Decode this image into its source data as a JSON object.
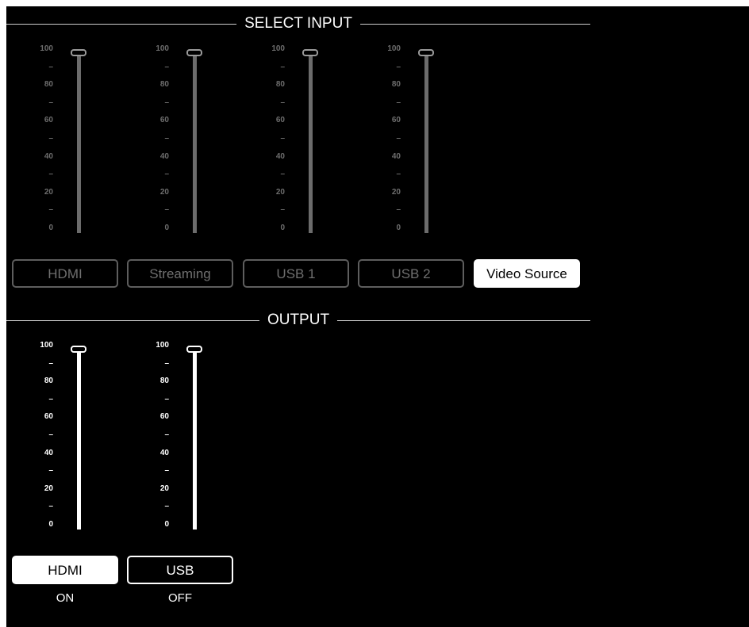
{
  "select_input": {
    "title": "SELECT INPUT",
    "sliders": [
      {
        "name": "HDMI",
        "value": 100
      },
      {
        "name": "Streaming",
        "value": 100
      },
      {
        "name": "USB 1",
        "value": 100
      },
      {
        "name": "USB 2",
        "value": 100
      }
    ],
    "buttons": [
      "HDMI",
      "Streaming",
      "USB 1",
      "USB 2",
      "Video Source"
    ],
    "selected": "Video Source"
  },
  "output": {
    "title": "OUTPUT",
    "sliders": [
      {
        "name": "HDMI",
        "value": 100
      },
      {
        "name": "USB",
        "value": 100
      }
    ],
    "buttons": [
      "HDMI",
      "USB"
    ],
    "states": [
      "ON",
      "OFF"
    ]
  },
  "scale_labels": [
    "100",
    "–",
    "80",
    "–",
    "60",
    "–",
    "40",
    "–",
    "20",
    "–",
    "0"
  ],
  "colors": {
    "background": "#000000",
    "bright": "#ffffff",
    "dim_text": "#6f6f6f",
    "dim_track": "#6c6c6c"
  }
}
